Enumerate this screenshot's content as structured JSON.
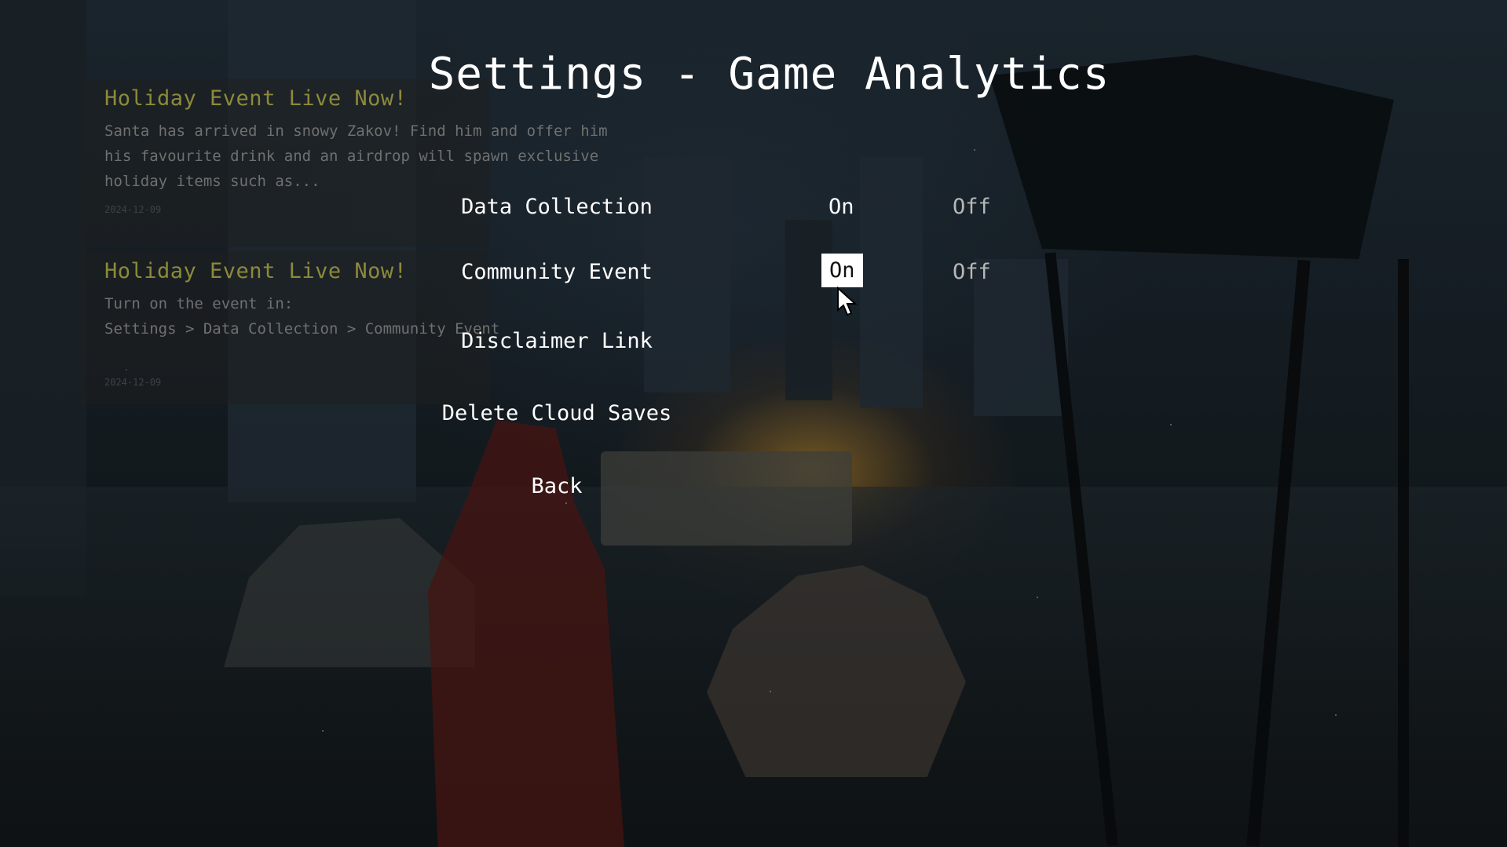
{
  "title": "Settings - Game Analytics",
  "news": [
    {
      "title": "Holiday Event Live Now!",
      "lines": [
        "Santa has arrived in snowy Zakov! Find him and offer him",
        "his favourite drink and an airdrop will spawn exclusive",
        "holiday items such as..."
      ],
      "date": "2024-12-09"
    },
    {
      "title": "Holiday Event Live Now!",
      "lines": [
        "Turn on the event in:",
        "Settings > Data Collection > Community Event"
      ],
      "date": "2024-12-09"
    }
  ],
  "settings": {
    "data_collection": {
      "label": "Data Collection",
      "on": "On",
      "off": "Off",
      "value": "On"
    },
    "community_event": {
      "label": "Community Event",
      "on": "On",
      "off": "Off",
      "value": "On"
    }
  },
  "actions": {
    "disclaimer": "Disclaimer Link",
    "delete_cloud": "Delete Cloud Saves",
    "back": "Back"
  },
  "colors": {
    "news_title": "#8c8a3a",
    "selected_bg": "#ffffff",
    "text": "#ffffff"
  }
}
